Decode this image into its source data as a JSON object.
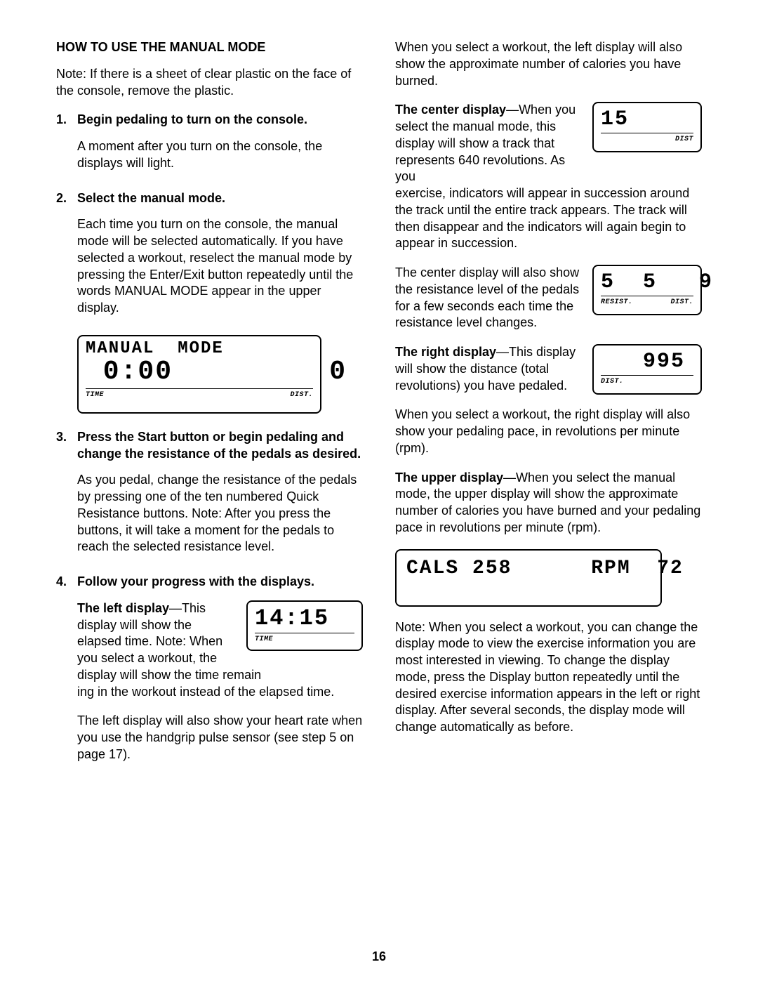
{
  "page_number": "16",
  "left": {
    "heading": "HOW TO USE THE MANUAL MODE",
    "note": "Note: If there is a sheet of clear plastic on the face of the console, remove the plastic.",
    "steps": [
      {
        "num": "1.",
        "title": "Begin pedaling to turn on the console.",
        "paras": [
          "A moment after you turn on the console, the displays will light."
        ]
      },
      {
        "num": "2.",
        "title": "Select the manual mode.",
        "paras": [
          "Each time you turn on the console, the manual mode will be selected automatically. If you have selected a workout, reselect the manual mode by pressing the Enter/Exit button repeatedly until the words MANUAL MODE appear in the upper display."
        ]
      },
      {
        "num": "3.",
        "title": "Press the Start button or begin pedaling and change the resistance of the pedals as desired.",
        "paras": [
          "As you pedal, change the resistance of the pedals by pressing one of the ten numbered Quick Resistance buttons. Note: After you press the buttons, it will take a moment for the pedals to reach the selected resistance level."
        ]
      },
      {
        "num": "4.",
        "title": "Follow your progress with the displays.",
        "paras": []
      }
    ],
    "left_display_lead": "The left display",
    "left_display_rest_start": "—This display will show the elapsed time. Note: When you select a workout, the display will show the time remain",
    "left_display_cont": "ing in the workout instead of the elapsed time.",
    "left_display_p2": "The left display will also show your heart rate when you use the handgrip pulse sensor (see step 5 on page 17).",
    "fig_manual": {
      "line1": "MANUAL  MODE",
      "line2": " 0:00         0",
      "label_left": "TIME",
      "label_right": "DIST."
    },
    "fig_left_display": {
      "big": "14:15",
      "label": "TIME"
    }
  },
  "right": {
    "intro": "When you select a workout, the left display will also show the approximate number of calories you have burned.",
    "center_heading": "The center display",
    "center_p1a": "—When you select the manual mode, this display will show a track that represents 640 revolutions. As you ",
    "center_p1b": "exercise, indicators will appear in succession around the track until the entire track appears. The track will then disappear and the indicators will again begin to appear in succession.",
    "center_p2": "The center display will also show the resistance level of the pedals for a few seconds each time the resistance level changes.",
    "fig_center1": {
      "big": "15      ",
      "label": "DIST"
    },
    "fig_center2": {
      "big": "5  5   9",
      "label_left": "RESIST.",
      "label_right": "DIST."
    },
    "right_heading": "The right display",
    "right_p1": "—This display will show the distance (total revolutions) you have pedaled.",
    "fig_right": {
      "big": "   995",
      "label": "DIST."
    },
    "right_p2": "When you select a workout, the right display will also show your pedaling pace, in revolutions per minute (rpm).",
    "upper_heading": "The upper display",
    "upper_p": "—When you select the manual mode, the upper display will show the approximate number of calories you have burned and your pedaling pace in revolutions per minute (rpm).",
    "fig_upper": {
      "line1": "CALS 258      RPM  72"
    },
    "note2": "Note: When you select a workout, you can change the display mode to view the exercise information you are most interested in viewing. To change the display mode, press the Display button repeatedly until the desired exercise information appears in the left or right display. After several seconds, the display mode will change automatically as before."
  }
}
